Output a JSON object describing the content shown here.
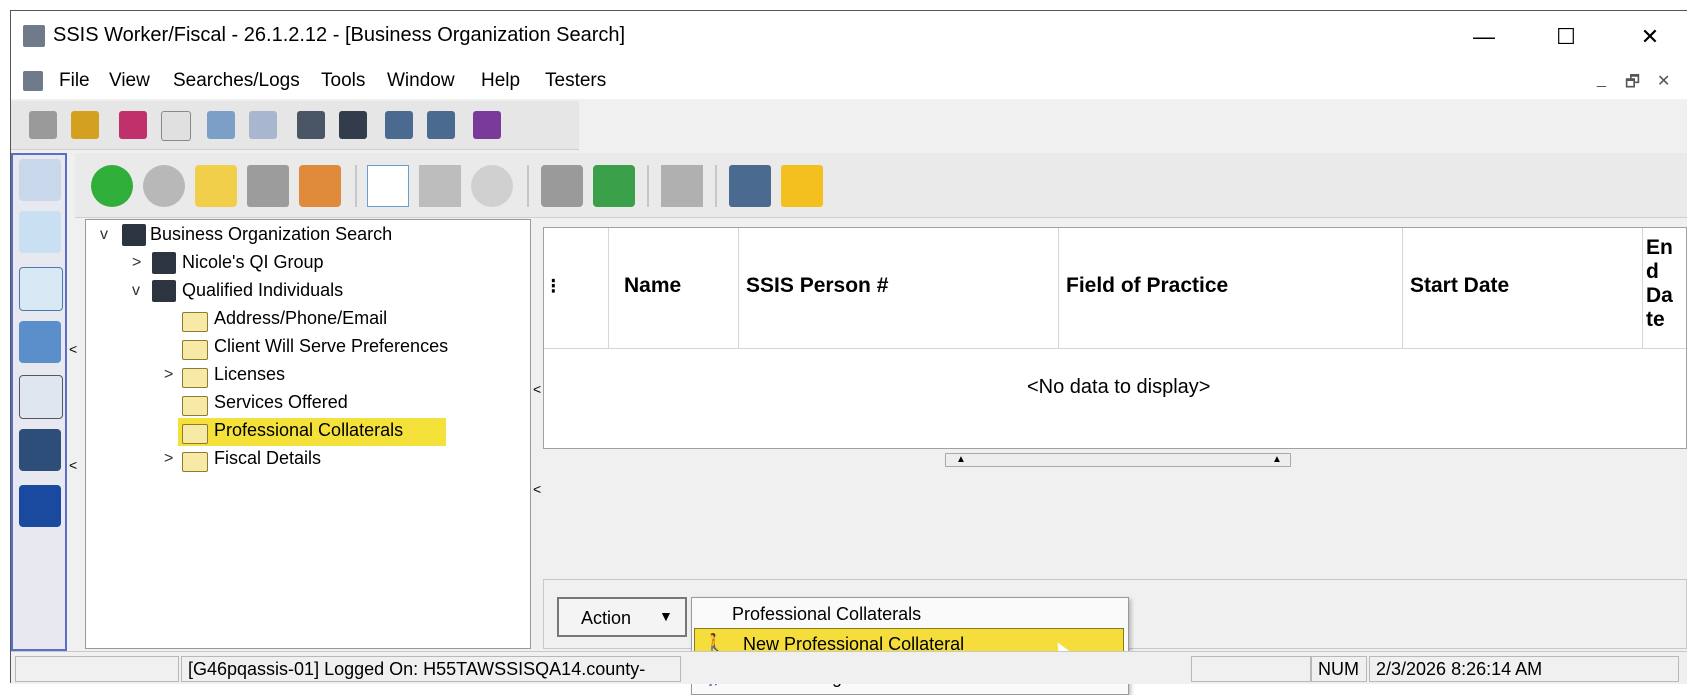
{
  "window": {
    "title": "SSIS Worker/Fiscal - 26.1.2.12 - [Business Organization Search]",
    "controls": {
      "minimize": "—",
      "maximize": "☐",
      "close": "✕"
    }
  },
  "menu": {
    "items": [
      "File",
      "View",
      "Searches/Logs",
      "Tools",
      "Window",
      "Help",
      "Testers"
    ],
    "mdi_controls": {
      "minimize": "_",
      "restore": "🗗",
      "close": "✕"
    }
  },
  "tree": {
    "root": "Business Organization Search",
    "nodes": [
      {
        "label": "Nicole's QI Group"
      },
      {
        "label": "Qualified Individuals"
      },
      {
        "label": "Address/Phone/Email"
      },
      {
        "label": "Client Will Serve Preferences"
      },
      {
        "label": "Licenses"
      },
      {
        "label": "Services Offered"
      },
      {
        "label": "Professional Collaterals",
        "selected": true
      },
      {
        "label": "Fiscal Details"
      }
    ]
  },
  "grid": {
    "columns": [
      "Name",
      "SSIS Person #",
      "Field of Practice",
      "Start Date",
      "End Date"
    ],
    "empty_text": "<No data to display>"
  },
  "action": {
    "button_label": "Action",
    "menu_header": "Professional Collaterals",
    "menu_items": [
      {
        "label": "New Professional Collateral",
        "highlighted": true
      },
      {
        "label": "Add Existing Professional Collateral",
        "highlighted": false
      }
    ]
  },
  "status": {
    "logon_text": "[G46pqassis-01] Logged On: H55TAWSSISQA14.county-",
    "num": "NUM",
    "datetime": "2/3/2026 8:26:14 AM"
  }
}
